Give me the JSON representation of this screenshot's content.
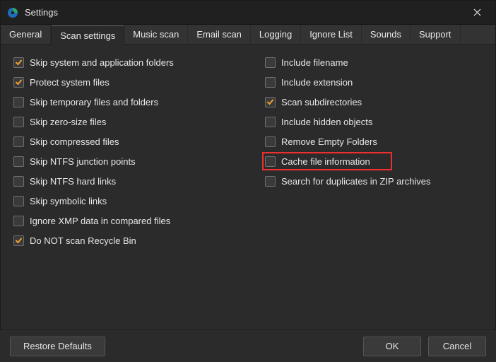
{
  "window": {
    "title": "Settings",
    "icon": "app-icon"
  },
  "tabs": [
    {
      "label": "General"
    },
    {
      "label": "Scan settings"
    },
    {
      "label": "Music scan"
    },
    {
      "label": "Email scan"
    },
    {
      "label": "Logging"
    },
    {
      "label": "Ignore List"
    },
    {
      "label": "Sounds"
    },
    {
      "label": "Support"
    }
  ],
  "active_tab": 1,
  "left_options": [
    {
      "label": "Skip system and application folders",
      "checked": true
    },
    {
      "label": "Protect system files",
      "checked": true
    },
    {
      "label": "Skip temporary files and folders",
      "checked": false
    },
    {
      "label": "Skip zero-size files",
      "checked": false
    },
    {
      "label": "Skip compressed files",
      "checked": false
    },
    {
      "label": "Skip NTFS junction points",
      "checked": false
    },
    {
      "label": "Skip NTFS hard links",
      "checked": false
    },
    {
      "label": "Skip symbolic links",
      "checked": false
    },
    {
      "label": "Ignore XMP data in compared files",
      "checked": false
    },
    {
      "label": "Do NOT scan Recycle Bin",
      "checked": true
    }
  ],
  "right_options": [
    {
      "label": "Include filename",
      "checked": false
    },
    {
      "label": "Include extension",
      "checked": false
    },
    {
      "label": "Scan subdirectories",
      "checked": true
    },
    {
      "label": "Include hidden objects",
      "checked": false
    },
    {
      "label": "Remove Empty Folders",
      "checked": false
    },
    {
      "label": "Cache file information",
      "checked": false,
      "highlight": true
    },
    {
      "label": "Search for duplicates in ZIP archives",
      "checked": false
    }
  ],
  "footer": {
    "restore": "Restore Defaults",
    "ok": "OK",
    "cancel": "Cancel"
  },
  "colors": {
    "accent_check": "#f0a030",
    "highlight_border": "#ef2e2e"
  }
}
